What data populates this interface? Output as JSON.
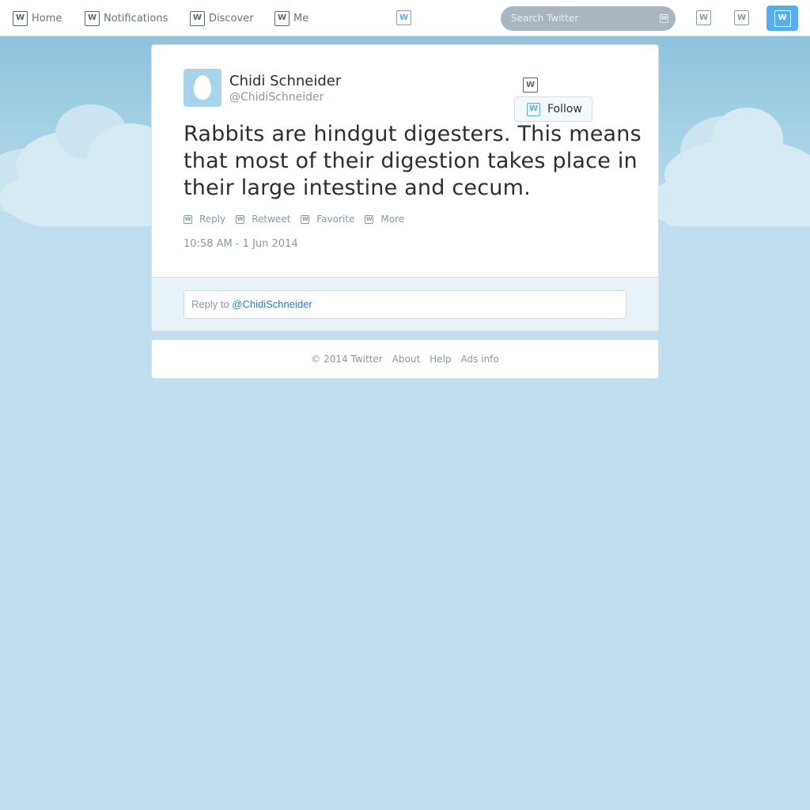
{
  "nav": {
    "items": [
      {
        "label": "Home",
        "icon": "home-icon"
      },
      {
        "label": "Notifications",
        "icon": "notifications-icon"
      },
      {
        "label": "Discover",
        "icon": "discover-icon"
      },
      {
        "label": "Me",
        "icon": "me-icon"
      }
    ],
    "search_placeholder": "Search Twitter"
  },
  "colors": {
    "accent": "#55acee",
    "background": "#c0deef",
    "link": "#2b7bb9"
  },
  "tweet": {
    "fullname": "Chidi Schneider",
    "handle": "@ChidiSchneider",
    "follow_label": "Follow",
    "text": "Rabbits are hindgut digesters. This means that most of their digestion takes place in their large intestine and cecum.",
    "actions": [
      "Reply",
      "Retweet",
      "Favorite",
      "More"
    ],
    "timestamp": "10:58 AM - 1 Jun 2014",
    "reply_prefix": "Reply to",
    "reply_mention": "@ChidiSchneider"
  },
  "footer": {
    "links": [
      "© 2014 Twitter",
      "About",
      "Help",
      "Ads info"
    ]
  }
}
